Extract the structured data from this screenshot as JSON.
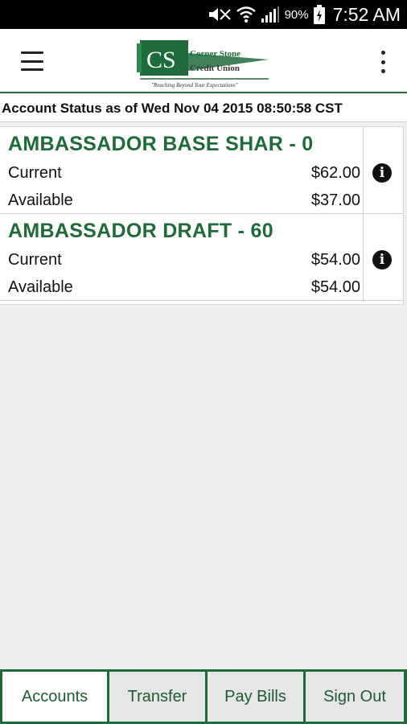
{
  "status_bar": {
    "battery_pct": "90%",
    "time": "7:52 AM",
    "icons": [
      "mute-icon",
      "wifi-icon",
      "signal-icon",
      "battery-icon"
    ]
  },
  "app_bar": {
    "menu_icon": "hamburger-menu-icon",
    "overflow_icon": "overflow-menu-icon",
    "logo": {
      "initials": "CS",
      "name_line1": "Corner Stone",
      "name_line2": "Credit Union",
      "tagline": "\"Reaching Beyond Your Expectations\""
    }
  },
  "status_line": "Account Status as of Wed Nov 04 2015 08:50:58 CST",
  "accounts": [
    {
      "name": "AMBASSADOR BASE SHAR - 0",
      "current_label": "Current",
      "current_value": "$62.00",
      "available_label": "Available",
      "available_value": "$37.00",
      "info_icon": "info-icon"
    },
    {
      "name": "AMBASSADOR DRAFT - 60",
      "current_label": "Current",
      "current_value": "$54.00",
      "available_label": "Available",
      "available_value": "$54.00",
      "info_icon": "info-icon"
    }
  ],
  "tabs": [
    {
      "label": "Accounts",
      "active": true
    },
    {
      "label": "Transfer",
      "active": false
    },
    {
      "label": "Pay Bills",
      "active": false
    },
    {
      "label": "Sign Out",
      "active": false
    }
  ],
  "colors": {
    "brand_green": "#1e6b3a",
    "background": "#efefef"
  }
}
